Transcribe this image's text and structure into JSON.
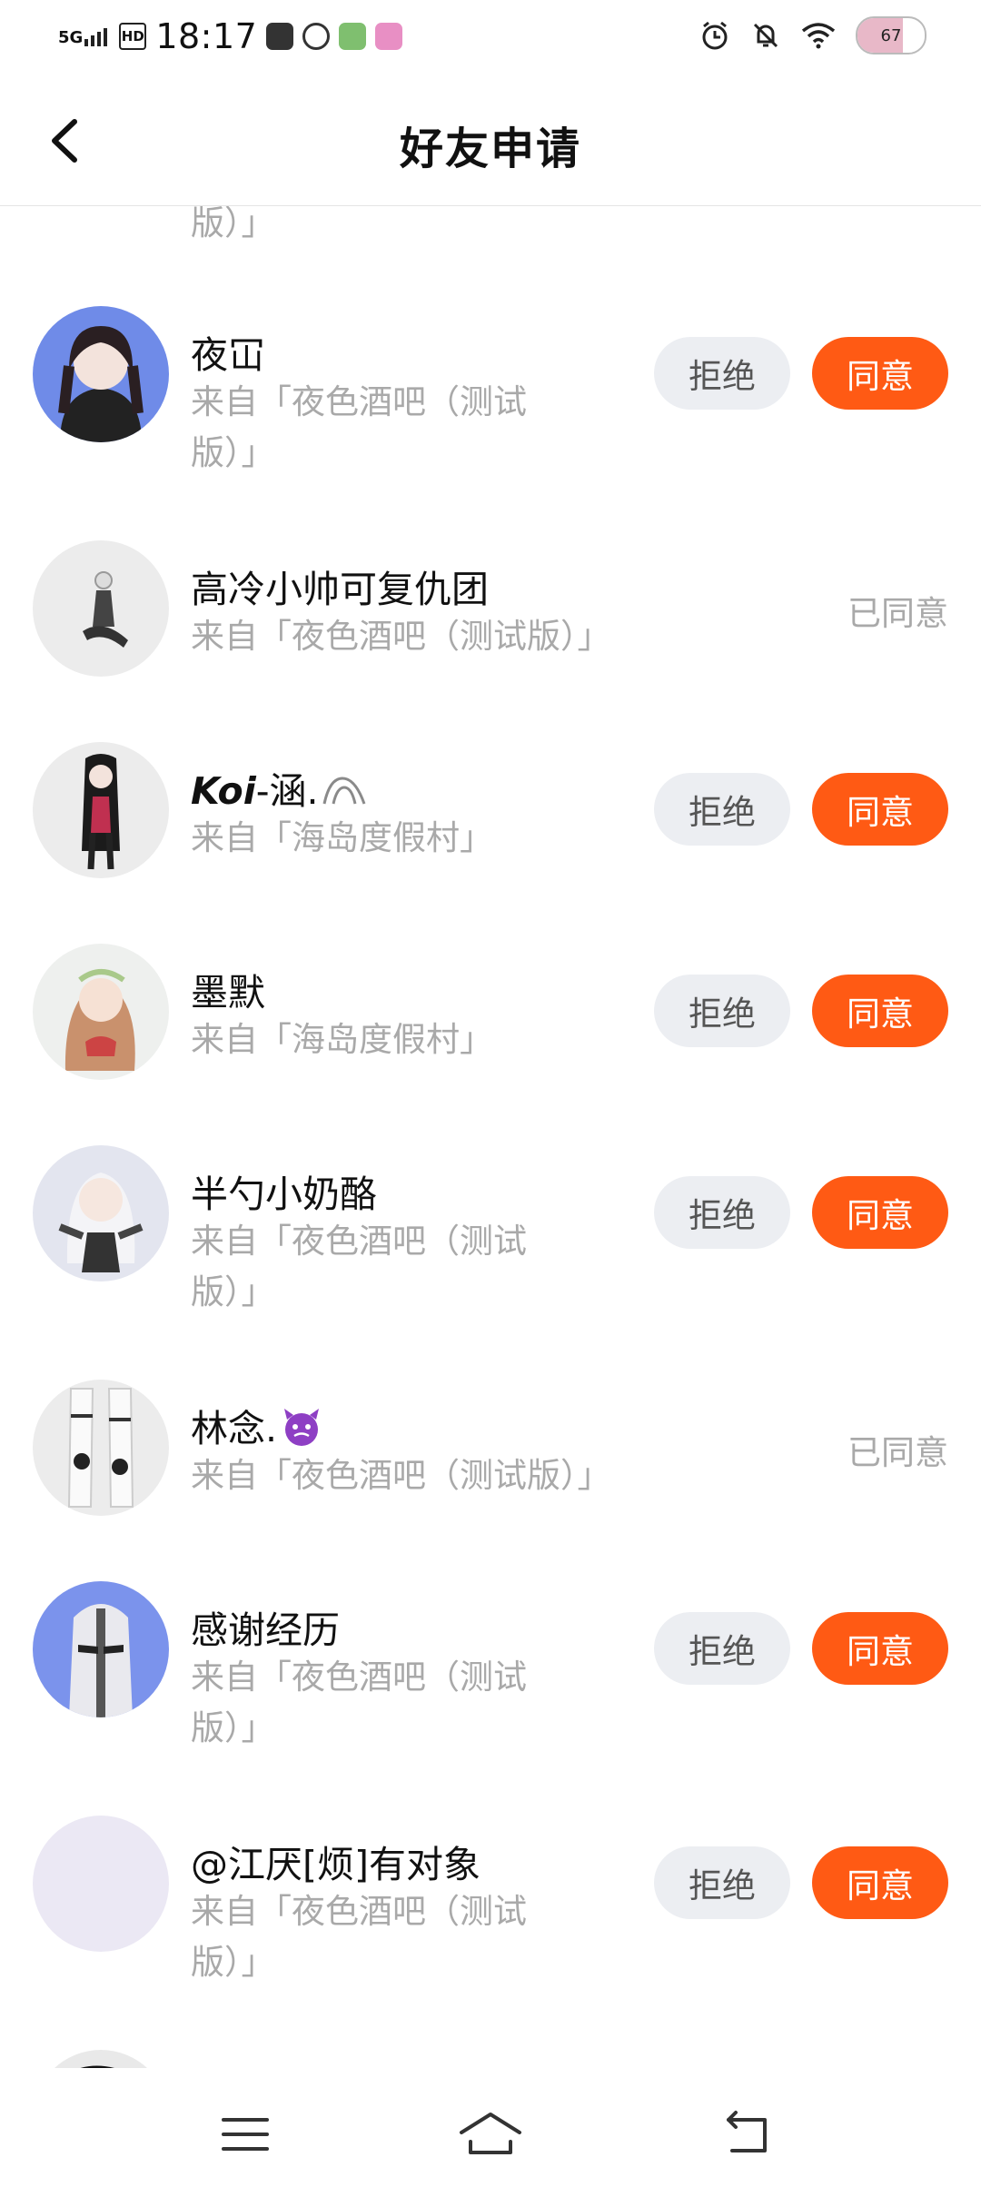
{
  "status_bar": {
    "network": "5G",
    "hd": "HD",
    "time": "18:17",
    "battery": "67",
    "battery_level": 0.67
  },
  "header": {
    "title": "好友申请"
  },
  "list": {
    "partial_top_text": "版）」",
    "reject_label": "拒绝",
    "accept_label": "同意",
    "accepted_label": "已同意",
    "requests": [
      {
        "name": "夜冚",
        "source": "来自「夜色酒吧（测试版）」",
        "state": "pending"
      },
      {
        "name": "高冷小帅可复仇团",
        "source": "来自「夜色酒吧（测试版）」",
        "state": "accepted"
      },
      {
        "name_prefix": "Koi",
        "name": "-涵.",
        "source": "来自「海岛度假村」",
        "state": "pending"
      },
      {
        "name": "墨默",
        "source": "来自「海岛度假村」",
        "state": "pending"
      },
      {
        "name": "半勺小奶酪",
        "source": "来自「夜色酒吧（测试版）」",
        "state": "pending"
      },
      {
        "name": "林念.",
        "source": "来自「夜色酒吧（测试版）」",
        "state": "accepted"
      },
      {
        "name": "感谢经历",
        "source": "来自「夜色酒吧（测试版）」",
        "state": "pending"
      },
      {
        "name": "@江厌[烦]有对象",
        "source": "来自「夜色酒吧（测试版）」",
        "state": "pending"
      }
    ]
  },
  "colors": {
    "accent": "#ff5a14",
    "secondary_text": "#a9a9a9",
    "reject_bg": "#eceef2"
  }
}
